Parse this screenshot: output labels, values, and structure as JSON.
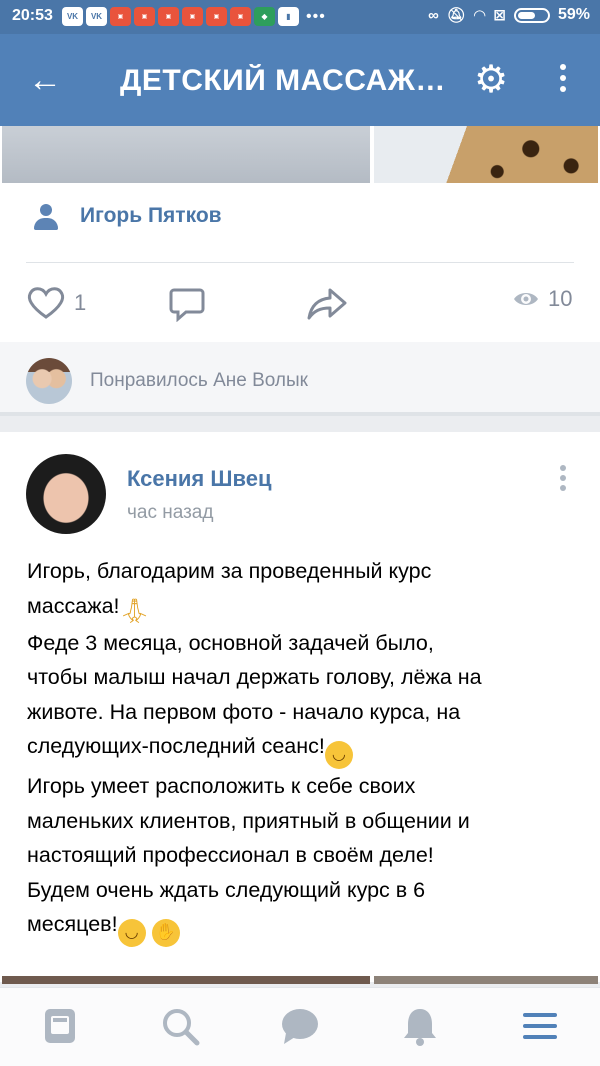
{
  "status_bar": {
    "time": "20:53",
    "battery": "59%",
    "battery_level": 0.59,
    "notification_icons": [
      "vk-icon",
      "vk-icon",
      "app-icon",
      "app-icon",
      "app-icon",
      "app-icon",
      "app-icon",
      "app-icon",
      "shield-icon",
      "app-icon"
    ],
    "overflow": "•••"
  },
  "header": {
    "title": "ДЕТСКИЙ МАССАЖ Н..."
  },
  "previous_post": {
    "author": "Игорь Пятков",
    "likes": "1",
    "views": "10",
    "liked_by": "Понравилось Ане Волык"
  },
  "post": {
    "author": "Ксения Швец",
    "time": "час назад",
    "lines": [
      "Игорь, благодарим за проведенный курс",
      "массажа!",
      "Феде 3 месяца, основной задачей было,",
      "чтобы малыш начал держать голову, лёжа на",
      "животе. На первом фото - начало курса, на",
      "следующих-последний сеанс!",
      "Игорь умеет расположить к себе своих",
      "маленьких клиентов, приятный в общении и",
      "настоящий профессионал в своём деле!",
      "Будем очень ждать следующий курс в 6",
      "месяцев!"
    ]
  },
  "tabs": [
    "news-icon",
    "search-icon",
    "messages-icon",
    "notifications-icon",
    "menu-icon"
  ],
  "colors": {
    "header": "#5181b8",
    "status_bar": "#4a76a8",
    "link": "#4a76a8",
    "muted": "#828a99"
  }
}
